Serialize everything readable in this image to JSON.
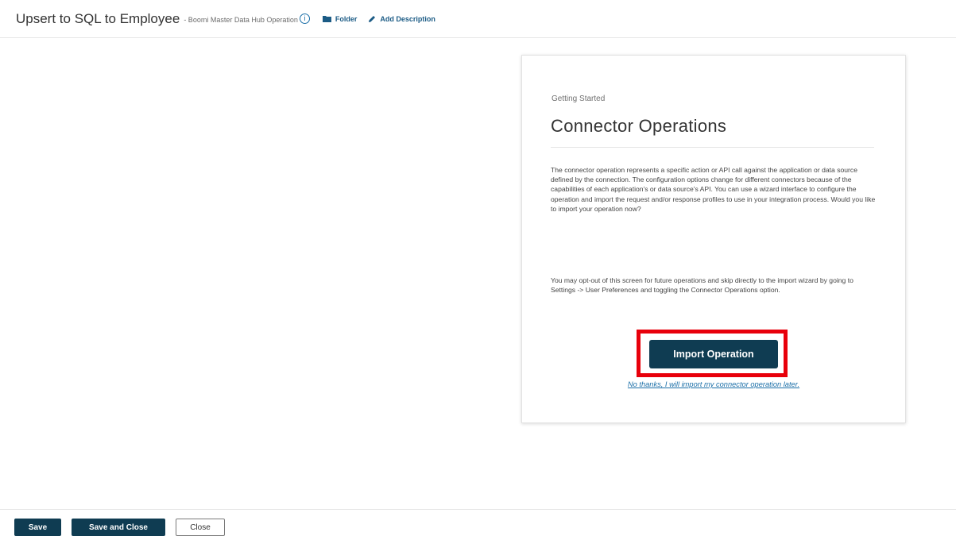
{
  "header": {
    "component_name": "Upsert to SQL to Employee",
    "component_type": "- Boomi Master Data Hub Operation",
    "info_icon": "info-icon",
    "folder_label": "Folder",
    "folder_icon": "folder-icon",
    "add_description_label": "Add Description",
    "add_description_icon": "pencil-icon"
  },
  "card": {
    "eyebrow": "Getting Started",
    "title": "Connector Operations",
    "paragraph1": "The connector operation represents a specific action or API call against the application or data source defined by the connection. The configuration options change for different connectors because of the capabilities of each application's or data source's API. You can use a wizard interface to configure the operation and import the request and/or response profiles to use in your integration process. Would you like to import your operation now?",
    "paragraph2": "You may opt-out of this screen for future operations and skip directly to the import wizard by going to Settings -> User Preferences and toggling the Connector Operations option.",
    "import_button_label": "Import Operation",
    "later_link": "No thanks, I will import my connector operation later.",
    "highlight_color": "#e8000b"
  },
  "footer": {
    "save_label": "Save",
    "save_close_label": "Save and Close",
    "close_label": "Close"
  },
  "colors": {
    "primary": "#0f3c52",
    "link": "#1b6fa8"
  }
}
